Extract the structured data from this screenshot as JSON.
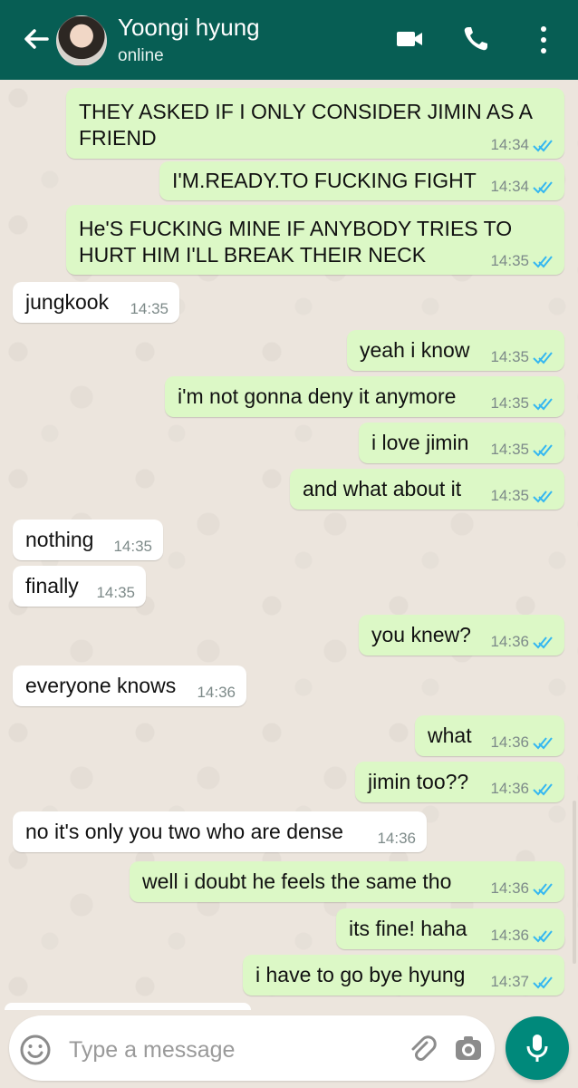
{
  "header": {
    "contact_name": "Yoongi hyung",
    "status": "online"
  },
  "colors": {
    "header": "#075e54",
    "outgoing_bubble": "#dcf8c6",
    "incoming_bubble": "#ffffff",
    "chat_background": "#ece5dd",
    "read_ticks": "#34b7f1",
    "mic_button": "#00897b"
  },
  "messages": [
    {
      "direction": "out",
      "text": "THEY ASKED IF I ONLY CONSIDER JIMIN AS A\nFRIEND",
      "time": "14:34",
      "read": true
    },
    {
      "direction": "out",
      "text": "I'M.READY.TO FUCKING FIGHT",
      "time": "14:34",
      "read": true
    },
    {
      "direction": "out",
      "text": "He'S FUCKING MINE IF ANYBODY TRIES TO\nHURT HIM I'LL BREAK THEIR NECK",
      "time": "14:35",
      "read": true
    },
    {
      "direction": "in",
      "text": "jungkook",
      "time": "14:35"
    },
    {
      "direction": "out",
      "text": "yeah i know",
      "time": "14:35",
      "read": true
    },
    {
      "direction": "out",
      "text": "i'm not gonna deny it anymore",
      "time": "14:35",
      "read": true
    },
    {
      "direction": "out",
      "text": "i love jimin",
      "time": "14:35",
      "read": true
    },
    {
      "direction": "out",
      "text": "and what about it",
      "time": "14:35",
      "read": true
    },
    {
      "direction": "in",
      "text": "nothing",
      "time": "14:35"
    },
    {
      "direction": "in",
      "text": "finally",
      "time": "14:35"
    },
    {
      "direction": "out",
      "text": "you knew?",
      "time": "14:36",
      "read": true
    },
    {
      "direction": "in",
      "text": "everyone knows",
      "time": "14:36"
    },
    {
      "direction": "out",
      "text": "what",
      "time": "14:36",
      "read": true
    },
    {
      "direction": "out",
      "text": "jimin too??",
      "time": "14:36",
      "read": true
    },
    {
      "direction": "in",
      "text": "no it's only you two who are dense",
      "time": "14:36"
    },
    {
      "direction": "out",
      "text": "well i doubt he feels the same tho",
      "time": "14:36",
      "read": true
    },
    {
      "direction": "out",
      "text": "its fine! haha",
      "time": "14:36",
      "read": true
    },
    {
      "direction": "out",
      "text": "i have to go bye hyung",
      "time": "14:37",
      "read": true
    }
  ],
  "composer": {
    "placeholder": "Type a message"
  },
  "icons": [
    "back-arrow-icon",
    "avatar",
    "video-call-icon",
    "phone-icon",
    "more-vert-icon",
    "emoji-icon",
    "attach-icon",
    "camera-icon",
    "mic-icon"
  ]
}
